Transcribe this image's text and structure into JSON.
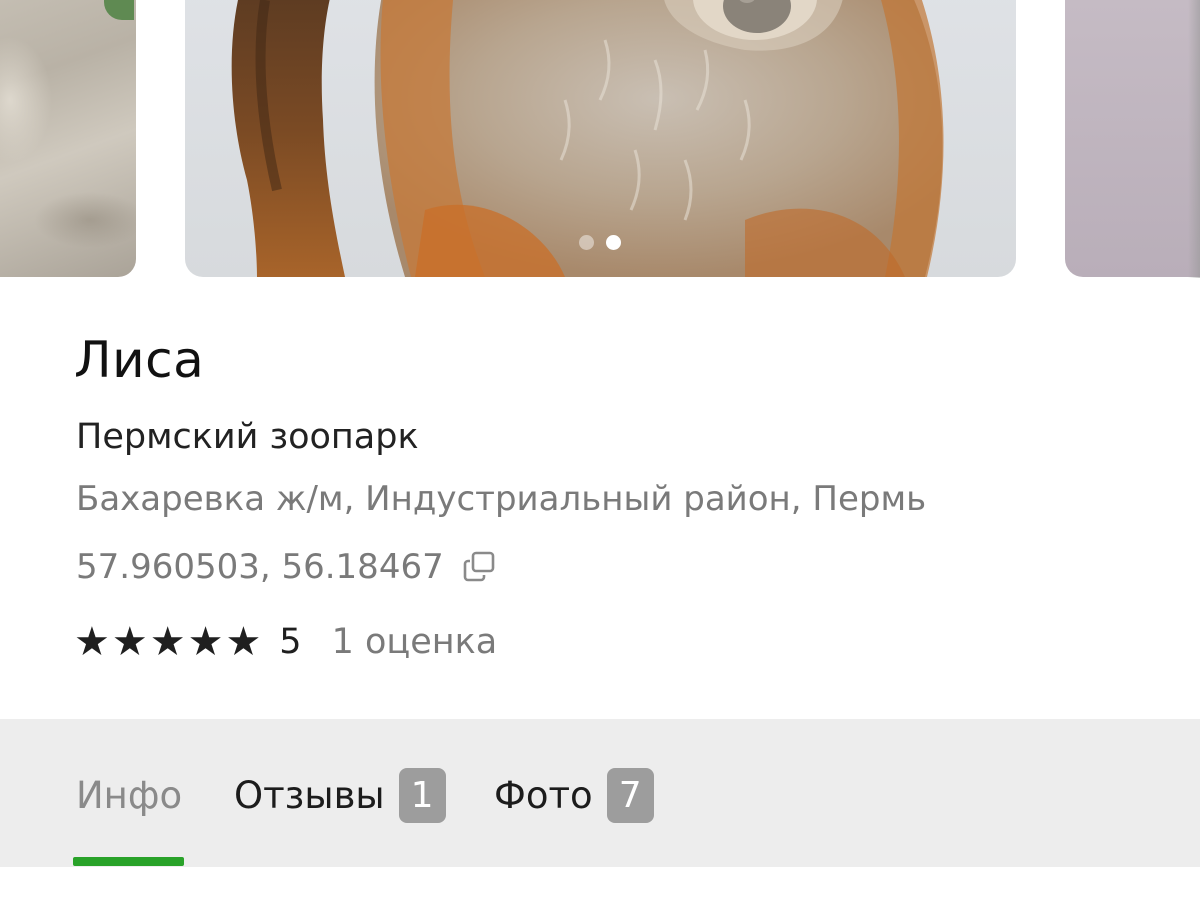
{
  "place": {
    "title": "Лиса",
    "subtitle": "Пермский зоопарк",
    "address": "Бахаревка ж/м, Индустриальный район, Пермь",
    "coordinates": "57.960503, 56.18467",
    "copy_icon": "copy-icon"
  },
  "rating": {
    "star_glyph": "★",
    "stars_filled": 5,
    "stars_total": 5,
    "value": "5",
    "count_text": "1 оценка"
  },
  "carousel": {
    "photo_count": 2,
    "active_index": 1
  },
  "tabs": [
    {
      "label": "Инфо",
      "badge": null,
      "active": true
    },
    {
      "label": "Отзывы",
      "badge": "1",
      "active": false
    },
    {
      "label": "Фото",
      "badge": "7",
      "active": false
    }
  ],
  "colors": {
    "accent": "#29a229",
    "badge_bg": "#9d9d9d",
    "tabs_bg": "#ededed",
    "secondary_text": "#7a7a7a"
  }
}
